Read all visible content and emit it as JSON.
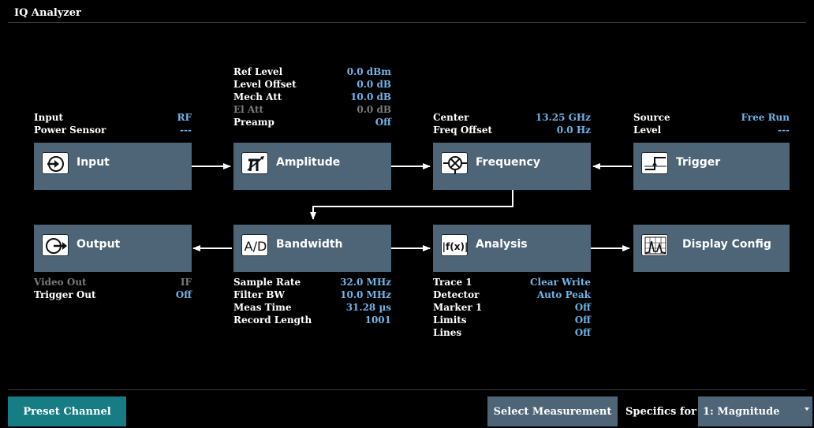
{
  "window": {
    "title": "IQ Analyzer"
  },
  "colors": {
    "background": "#000000",
    "block": "#4d6577",
    "value": "#6fb4e8",
    "dim": "#7a7a7a",
    "preset": "#177d85"
  },
  "input_params": {
    "rows": [
      {
        "label": "Input",
        "value": "RF",
        "dim": false
      },
      {
        "label": "Power Sensor",
        "value": "---",
        "dim": false
      }
    ]
  },
  "amplitude_params": {
    "rows": [
      {
        "label": "Ref Level",
        "value": "0.0 dBm",
        "dim": false
      },
      {
        "label": "Level Offset",
        "value": "0.0 dB",
        "dim": false
      },
      {
        "label": "Mech Att",
        "value": "10.0 dB",
        "dim": false
      },
      {
        "label": "El Att",
        "value": "0.0 dB",
        "dim": true
      },
      {
        "label": "Preamp",
        "value": "Off",
        "dim": false
      }
    ]
  },
  "frequency_params": {
    "rows": [
      {
        "label": "Center",
        "value": "13.25 GHz",
        "dim": false
      },
      {
        "label": "Freq Offset",
        "value": "0.0 Hz",
        "dim": false
      }
    ]
  },
  "trigger_params": {
    "rows": [
      {
        "label": "Source",
        "value": "Free Run",
        "dim": false
      },
      {
        "label": "Level",
        "value": "---",
        "dim": false
      }
    ]
  },
  "blocks": {
    "input": {
      "label": "Input",
      "icon": "input-icon"
    },
    "amplitude": {
      "label": "Amplitude",
      "icon": "attenuator-icon"
    },
    "frequency": {
      "label": "Frequency",
      "icon": "mixer-icon"
    },
    "trigger": {
      "label": "Trigger",
      "icon": "trigger-edge-icon"
    },
    "output": {
      "label": "Output",
      "icon": "output-icon"
    },
    "bandwidth": {
      "label": "Bandwidth",
      "icon": "ad-converter-icon",
      "icon_text": "A/D"
    },
    "analysis": {
      "label": "Analysis",
      "icon": "function-icon",
      "icon_text": "|f(x)|"
    },
    "display_config": {
      "label": "Display Config",
      "icon": "display-spectrum-icon"
    }
  },
  "output_params": {
    "rows": [
      {
        "label": "Video Out",
        "value": "IF",
        "dim": true
      },
      {
        "label": "Trigger Out",
        "value": "Off",
        "dim": false
      }
    ]
  },
  "bandwidth_params": {
    "rows": [
      {
        "label": "Sample Rate",
        "value": "32.0 MHz",
        "dim": false
      },
      {
        "label": "Filter BW",
        "value": "10.0 MHz",
        "dim": false
      },
      {
        "label": "Meas Time",
        "value": "31.28 µs",
        "dim": false
      },
      {
        "label": "Record Length",
        "value": "1001",
        "dim": false
      }
    ]
  },
  "analysis_params": {
    "rows": [
      {
        "label": "Trace 1",
        "value": "Clear Write",
        "dim": false
      },
      {
        "label": "Detector",
        "value": "Auto Peak",
        "dim": false
      },
      {
        "label": "Marker 1",
        "value": "Off",
        "dim": false
      },
      {
        "label": "Limits",
        "value": "Off",
        "dim": false
      },
      {
        "label": "Lines",
        "value": "Off",
        "dim": false
      }
    ]
  },
  "softkeys": {
    "preset_channel": "Preset Channel",
    "select_measurement": "Select Measurement",
    "specifics_label": "Specifics for",
    "specifics_value": "1: Magnitude"
  }
}
